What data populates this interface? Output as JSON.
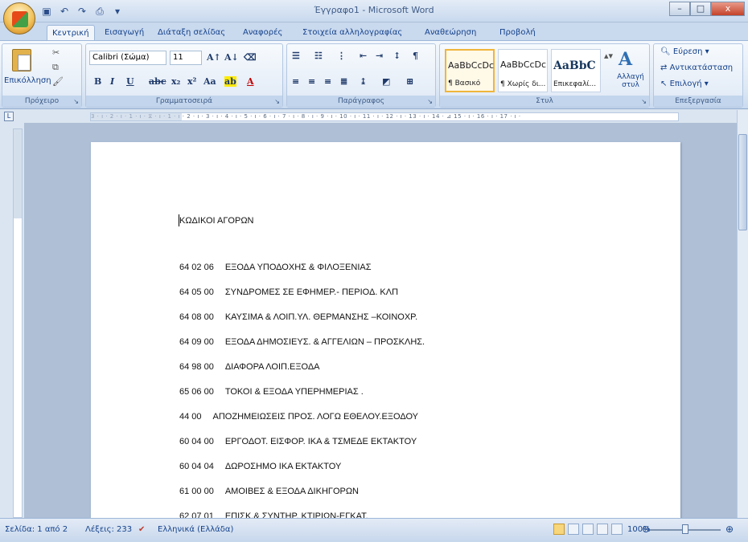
{
  "window": {
    "title": "Έγγραφο1 - Microsoft Word",
    "buttons": {
      "minimize": "–",
      "maximize": "□",
      "close": "x"
    }
  },
  "quick_access": {
    "save_icon": "save-icon",
    "undo_icon": "undo-icon",
    "redo_icon": "redo-icon",
    "print_icon": "print-preview-icon"
  },
  "tabs": [
    {
      "label": "Κεντρική",
      "active": true
    },
    {
      "label": "Εισαγωγή"
    },
    {
      "label": "Διάταξη σελίδας"
    },
    {
      "label": "Αναφορές"
    },
    {
      "label": "Στοιχεία αλληλογραφίας"
    },
    {
      "label": "Αναθεώρηση"
    },
    {
      "label": "Προβολή"
    }
  ],
  "ribbon": {
    "clipboard": {
      "paste": "Επικόλληση",
      "group": "Πρόχειρο"
    },
    "font": {
      "name": "Calibri (Σώμα)",
      "size": "11",
      "group": "Γραμματοσειρά"
    },
    "paragraph": {
      "group": "Παράγραφος"
    },
    "styles": {
      "items": [
        {
          "sample": "AaBbCcDc",
          "name": "¶ Βασικό"
        },
        {
          "sample": "AaBbCcDc",
          "name": "¶ Χωρίς δι..."
        },
        {
          "sample": "AaBbC",
          "name": "Επικεφαλί..."
        }
      ],
      "change_styles": "Αλλαγή στυλ",
      "group": "Στυλ"
    },
    "editing": {
      "find": "Εύρεση",
      "replace": "Αντικατάσταση",
      "select": "Επιλογή",
      "group": "Επεξεργασία"
    }
  },
  "ruler": {
    "text": "3 · ı · 2 · ı · 1 · ı ·  ⧖ · ı · 1 · ı · 2 · ı · 3 · ı · 4 · ı · 5 · ı · 6 · ı · 7 · ı · 8 · ı · 9 · ı · 10 · ı · 11 · ı · 12 · ı · 13 · ı · 14 · ⊿ 15 · ı · 16 · ı · 17 · ı ·"
  },
  "document": {
    "title": "ΚΩΔΙΚΟΙ ΑΓΟΡΩΝ",
    "lines": [
      {
        "code": "64 02 06",
        "text": "ΕΞΟΔΑ ΥΠΟΔΟΧΗΣ & ΦΙΛΟΞΕΝΙΑΣ"
      },
      {
        "code": "64 05 00",
        "text": "ΣΥΝΔΡΟΜΕΣ ΣΕ ΕΦΗΜΕΡ.- ΠΕΡΙΟΔ. ΚΛΠ"
      },
      {
        "code": "64 08 00",
        "text": "ΚΑΥΣΙΜΑ & ΛΟΙΠ.ΥΛ. ΘΕΡΜΑΝΣΗΣ –ΚΟΙΝΟΧΡ."
      },
      {
        "code": "64 09 00",
        "text": "ΕΞΟΔΑ ΔΗΜΟΣΙΕΥΣ. & ΑΓΓΕΛΙΩΝ – ΠΡΟΣΚΛΗΣ."
      },
      {
        "code": "64 98 00",
        "text": "ΔΙΑΦΟΡΑ ΛΟΙΠ.ΕΞΟΔΑ"
      },
      {
        "code": "65 06 00",
        "text": "ΤΟΚΟΙ & ΕΞΟΔΑ ΥΠΕΡΗΜΕΡΙΑΣ ."
      },
      {
        "code": "44 00",
        "text": "ΑΠΟΖΗΜΕΙΩΣΕΙΣ ΠΡΟΣ. ΛΟΓΩ ΕΘΕΛΟΥ.ΕΞΟΔΟΥ"
      },
      {
        "code": "60 04 00",
        "text": "ΕΡΓΟΔΟΤ. ΕΙΣΦΟΡ. ΙΚΑ & ΤΣΜΕΔΕ ΕΚΤΑΚΤΟΥ"
      },
      {
        "code": "60 04 04",
        "text": "ΔΩΡΟΣΗΜΟ ΙΚΑ ΕΚΤΑΚΤΟΥ"
      },
      {
        "code": "61 00 00",
        "text": "ΑΜΟΙΒΕΣ & ΕΞΟΔΑ ΔΙΚΗΓΟΡΩΝ"
      },
      {
        "code": "62 07 01",
        "text": "ΕΠΙΣΚ.& ΣΥΝΤΗΡ. ΚΤΙΡΙΩΝ-ΕΓΚΑΤ."
      }
    ]
  },
  "status": {
    "page": "Σελίδα: 1 από 2",
    "words": "Λέξεις: 233",
    "language": "Ελληνικά (Ελλάδα)",
    "zoom": "100%"
  }
}
